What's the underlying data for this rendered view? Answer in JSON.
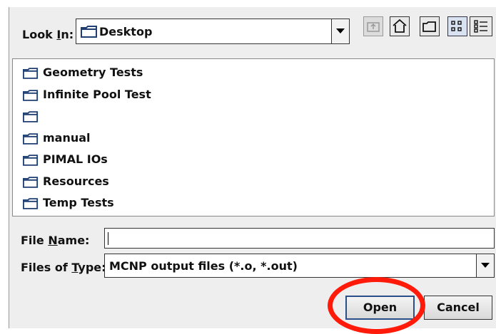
{
  "look_in": {
    "label_prefix": "Look ",
    "label_mnemonic": "I",
    "label_suffix": "n:",
    "selected": "Desktop"
  },
  "toolbar": {
    "buttons": [
      "up-one-level-icon",
      "home-icon",
      "new-folder-icon",
      "list-view-icon",
      "details-view-icon"
    ]
  },
  "files": [
    {
      "name": "Geometry Tests"
    },
    {
      "name": "Infinite Pool Test"
    },
    {
      "name": ""
    },
    {
      "name": "manual"
    },
    {
      "name": "PIMAL IOs"
    },
    {
      "name": "Resources"
    },
    {
      "name": "Temp Tests"
    }
  ],
  "file_name": {
    "label_prefix": "File ",
    "label_mnemonic": "N",
    "label_suffix": "ame:",
    "value": ""
  },
  "file_type": {
    "label_prefix": "Files of ",
    "label_mnemonic": "T",
    "label_suffix": "ype:",
    "selected": "MCNP output files (*.o, *.out)"
  },
  "buttons": {
    "open": "Open",
    "cancel": "Cancel"
  },
  "colors": {
    "highlight_circle": "#ff1a0a",
    "folder_stroke": "#1f3f72"
  }
}
